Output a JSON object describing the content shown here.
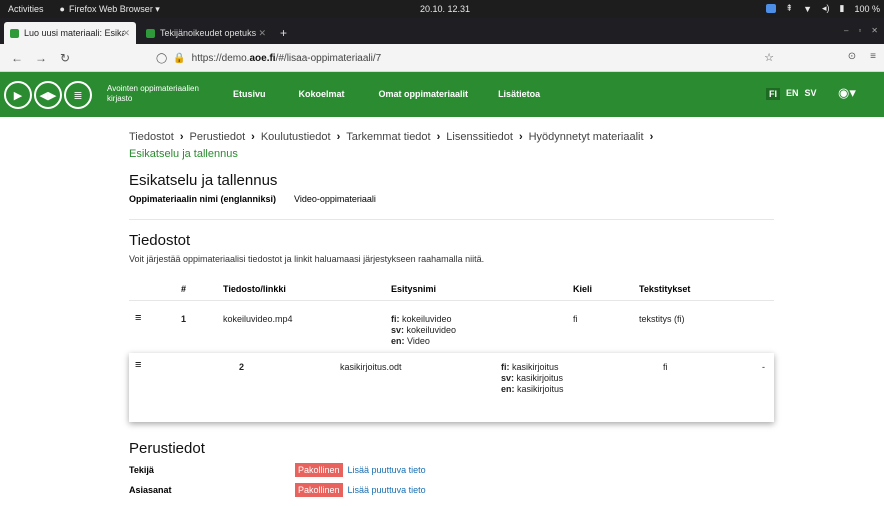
{
  "os": {
    "activities": "Activities",
    "app_name": "Firefox Web Browser ▾",
    "clock": "20.10.  12.31",
    "battery": "100 %"
  },
  "browser": {
    "tabs": [
      {
        "title": "Luo uusi materiaali: Esika",
        "active": true
      },
      {
        "title": "Tekijänoikeudet opetuks",
        "active": false
      }
    ],
    "url_prefix": "https://demo.",
    "url_domain": "aoe.fi",
    "url_suffix": "/#/lisaa-oppimateriaali/7"
  },
  "site": {
    "logo_text": "Avointen oppimateriaalien kirjasto",
    "nav": [
      "Etusivu",
      "Kokoelmat",
      "Omat oppimateriaalit",
      "Lisätietoa"
    ],
    "languages": [
      "FI",
      "EN",
      "SV"
    ],
    "active_language": "FI"
  },
  "breadcrumbs": {
    "items": [
      "Tiedostot",
      "Perustiedot",
      "Koulutustiedot",
      "Tarkemmat tiedot",
      "Lisenssitiedot",
      "Hyödynnetyt materiaalit"
    ],
    "current": "Esikatselu ja tallennus"
  },
  "preview": {
    "heading": "Esikatselu ja tallennus",
    "name_label": "Oppimateriaalin nimi (englanniksi)",
    "name_value": "Video-oppimateriaali"
  },
  "files": {
    "heading": "Tiedostot",
    "description": "Voit järjestää oppimateriaalisi tiedostot ja linkit haluamaasi järjestykseen raahamalla niitä.",
    "columns": [
      "#",
      "Tiedosto/linkki",
      "Esitysnimi",
      "Kieli",
      "Tekstitykset"
    ],
    "rows": [
      {
        "num": "1",
        "file": "kokeiluvideo.mp4",
        "names": {
          "fi": "kokeiluvideo",
          "sv": "kokeiluvideo",
          "en": "Video"
        },
        "lang": "fi",
        "subs": "tekstitys (fi)"
      },
      {
        "num": "2",
        "file": "kasikirjoitus.odt",
        "names": {
          "fi": "kasikirjoitus",
          "sv": "kasikirjoitus",
          "en": "kasikirjoitus"
        },
        "lang": "fi",
        "subs": "-"
      }
    ]
  },
  "basic": {
    "heading": "Perustiedot",
    "required_label": "Pakollinen",
    "missing_link": "Lisää puuttuva tieto",
    "fields": [
      "Tekijä",
      "Asiasanat"
    ]
  },
  "colors": {
    "brand_green": "#2a8b30",
    "required_red": "#e8625e",
    "link_blue": "#1a6fb0"
  }
}
